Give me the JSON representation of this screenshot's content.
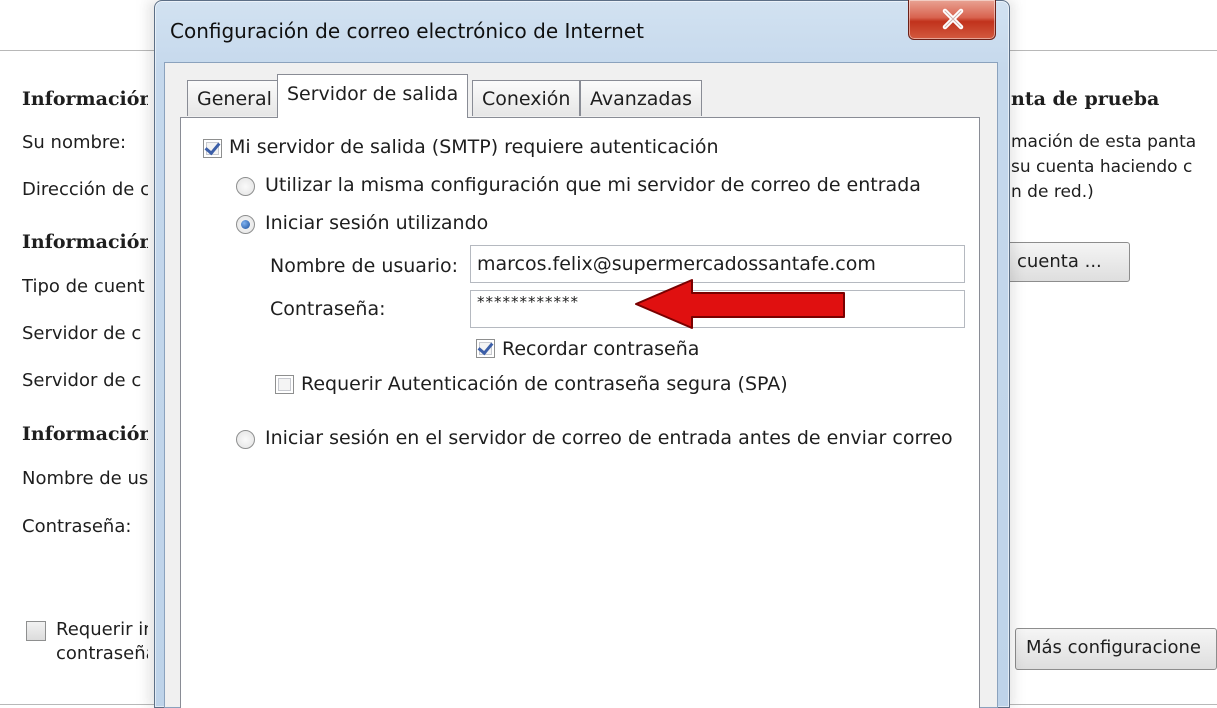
{
  "background_window": {
    "heading_user_info": "Información",
    "your_name_label": "Su nombre:",
    "email_label": "Dirección de c",
    "heading_server_info": "Información",
    "account_type_label": "Tipo de cuent",
    "incoming_server_label": "Servidor de c",
    "outgoing_server_label": "Servidor de c",
    "heading_logon_info": "Información",
    "username_label": "Nombre de us",
    "password_label": "Contraseña:",
    "require_spa_line1": "Requerir in",
    "require_spa_line2": "contraseña",
    "test_heading": "nta de prueba",
    "test_desc_line1": "mación de esta panta",
    "test_desc_line2": "su cuenta haciendo c",
    "test_desc_line3": "n de red.)",
    "test_button": "cuenta ...",
    "more_settings_button": "Más configuracione"
  },
  "dialog": {
    "title": "Configuración de correo electrónico de Internet",
    "tabs": [
      {
        "label": "General",
        "active": false
      },
      {
        "label": "Servidor de salida",
        "active": true
      },
      {
        "label": "Conexión",
        "active": false
      },
      {
        "label": "Avanzadas",
        "active": false
      }
    ],
    "smtp_auth": {
      "label": "Mi servidor de salida (SMTP) requiere autenticación",
      "checked": true
    },
    "same_settings": {
      "label": "Utilizar la misma configuración que mi servidor de correo de entrada",
      "selected": false
    },
    "logon_using": {
      "label": "Iniciar sesión utilizando",
      "selected": true
    },
    "username": {
      "label": "Nombre de usuario:",
      "value": "marcos.felix@supermercadossantafe.com"
    },
    "password": {
      "label": "Contraseña:",
      "value": "************"
    },
    "remember_password": {
      "label": "Recordar contraseña",
      "checked": true
    },
    "require_spa": {
      "label": "Requerir Autenticación de contraseña segura (SPA)",
      "checked": false
    },
    "logon_before_send": {
      "label": "Iniciar sesión en el servidor de correo de entrada antes de enviar correo",
      "selected": false
    }
  },
  "annotation": {
    "arrow_color": "#e01010"
  }
}
